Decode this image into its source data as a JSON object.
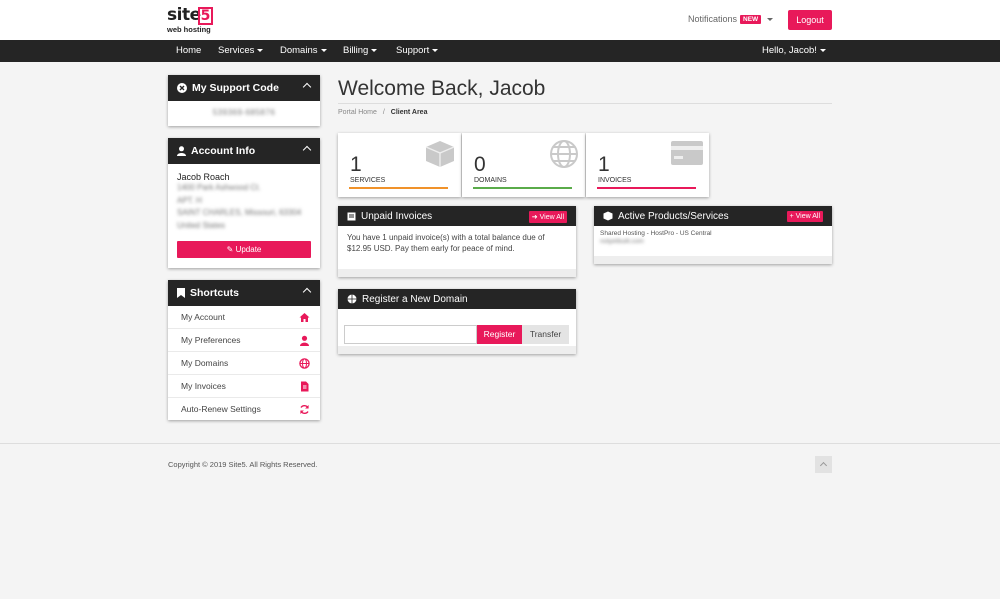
{
  "brand": {
    "name": "site",
    "number": "5",
    "tagline": "web hosting"
  },
  "header": {
    "notifications_label": "Notifications",
    "new_badge": "NEW",
    "logout_label": "Logout"
  },
  "nav": {
    "items": [
      "Home",
      "Services",
      "Domains",
      "Billing",
      "Support"
    ],
    "user_greeting": "Hello, Jacob!"
  },
  "support_code": {
    "title": "My Support Code",
    "value": "539369-685876"
  },
  "account": {
    "title": "Account Info",
    "name": "Jacob Roach",
    "lines": [
      "1400 Park Ashwood Ct.",
      "APT. H",
      "SAINT CHARLES, Missouri, 63304",
      "United States"
    ],
    "update_label": "Update"
  },
  "shortcuts": {
    "title": "Shortcuts",
    "items": [
      {
        "label": "My Account",
        "icon": "home-icon"
      },
      {
        "label": "My Preferences",
        "icon": "user-icon"
      },
      {
        "label": "My Domains",
        "icon": "globe-icon"
      },
      {
        "label": "My Invoices",
        "icon": "invoice-icon"
      },
      {
        "label": "Auto-Renew Settings",
        "icon": "refresh-icon"
      }
    ]
  },
  "main": {
    "title": "Welcome Back, Jacob",
    "breadcrumb": {
      "home": "Portal Home",
      "sep": "/",
      "current": "Client Area"
    }
  },
  "stats": [
    {
      "value": "1",
      "label": "SERVICES",
      "color": "#f0922a",
      "icon": "box-icon"
    },
    {
      "value": "0",
      "label": "DOMAINS",
      "color": "#5aab4a",
      "icon": "globe-icon"
    },
    {
      "value": "1",
      "label": "INVOICES",
      "color": "#e8195a",
      "icon": "credit-card-icon"
    }
  ],
  "unpaid": {
    "title": "Unpaid Invoices",
    "button": "View All",
    "message": "You have 1 unpaid invoice(s) with a total balance due of $12.95 USD. Pay them early for peace of mind."
  },
  "products": {
    "title": "Active Products/Services",
    "button": "View All",
    "product": "Shared Hosting - HostPro - US Central",
    "domain": "notyetbuilt.com"
  },
  "register": {
    "title": "Register a New Domain",
    "input_placeholder": "",
    "register_label": "Register",
    "transfer_label": "Transfer"
  },
  "footer": {
    "copyright": "Copyright © 2019 Site5. All Rights Reserved."
  },
  "colors": {
    "accent": "#e8195a",
    "dark": "#252525"
  }
}
